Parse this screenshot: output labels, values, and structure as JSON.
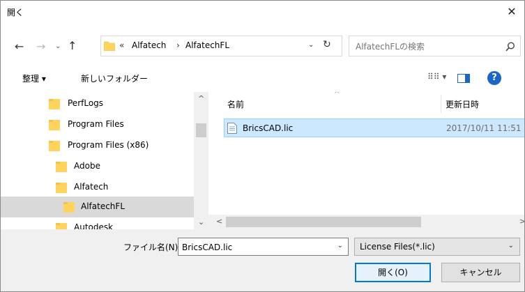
{
  "window": {
    "title": "開く",
    "close_glyph": "✕"
  },
  "navigation": {
    "back_glyph": "←",
    "forward_glyph": "→",
    "recent_glyph": "⌄",
    "up_glyph": "↑"
  },
  "address": {
    "overflow": "«",
    "segments": [
      "Alfatech",
      "AlfatechFL"
    ],
    "separator": "›",
    "dropdown_glyph": "⌄",
    "refresh_glyph": "↻"
  },
  "search": {
    "placeholder": "AlfatechFLの検索"
  },
  "toolbar": {
    "organize_label": "整理 ▾",
    "new_folder_label": "新しいフォルダー",
    "view_label": "⠿⠿ ▾",
    "help_label": "?"
  },
  "tree": {
    "items": [
      {
        "label": "PerfLogs"
      },
      {
        "label": "Program Files"
      },
      {
        "label": "Program Files (x86)"
      },
      {
        "label": "Adobe"
      },
      {
        "label": "Alfatech"
      },
      {
        "label": "AlfatechFL"
      },
      {
        "label": "Autodesk"
      }
    ],
    "selected": "AlfatechFL"
  },
  "file_list": {
    "columns": {
      "name": "名前",
      "date": "更新日時"
    },
    "sort_glyph": "^",
    "files": [
      {
        "name": "BricsCAD.lic",
        "date": "2017/10/11 11:51"
      }
    ]
  },
  "scroll": {
    "up": "^",
    "down": "⌄",
    "left": "<",
    "right": ">"
  },
  "footer": {
    "filename_label": "ファイル名(N):",
    "filename_value": "BricsCAD.lic",
    "filename_drop": "⌄",
    "filetype_value": "License Files(*.lic)",
    "filetype_drop": "⌄",
    "open_button": "開く(O)",
    "cancel_button": "キャンセル"
  },
  "colors": {
    "accent": "#0078d7",
    "folder": "#ffd35c",
    "selection": "#cce8ff",
    "tree_selection": "#d9d9d9",
    "chrome": "#f0f0f0"
  }
}
